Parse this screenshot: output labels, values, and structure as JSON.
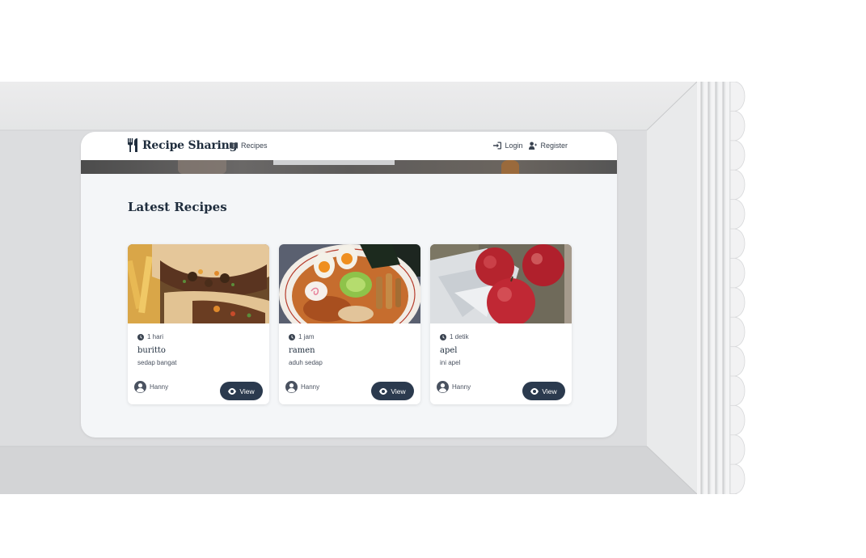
{
  "app": {
    "brand_name": "Recipe Sharing",
    "brand_icon": "utensils-icon"
  },
  "nav": {
    "recipes_label": "Recipes",
    "recipes_icon": "book-open-icon",
    "login_label": "Login",
    "login_icon": "sign-in-icon",
    "register_label": "Register",
    "register_icon": "user-plus-icon"
  },
  "main": {
    "section_title": "Latest Recipes",
    "recipes": [
      {
        "time": "1 hari",
        "title": "buritto",
        "description": "sedap bangat",
        "author": "Hanny",
        "view_label": "View",
        "image": "burrito-photo"
      },
      {
        "time": "1 jam",
        "title": "ramen",
        "description": "aduh sedap",
        "author": "Hanny",
        "view_label": "View",
        "image": "ramen-photo"
      },
      {
        "time": "1 detik",
        "title": "apel",
        "description": "ini apel",
        "author": "Hanny",
        "view_label": "View",
        "image": "apples-painting"
      }
    ]
  },
  "colors": {
    "primary_dark": "#2b3a4e",
    "heading": "#1f2d3d",
    "page_bg": "#f4f6f8",
    "card_bg": "#ffffff"
  }
}
